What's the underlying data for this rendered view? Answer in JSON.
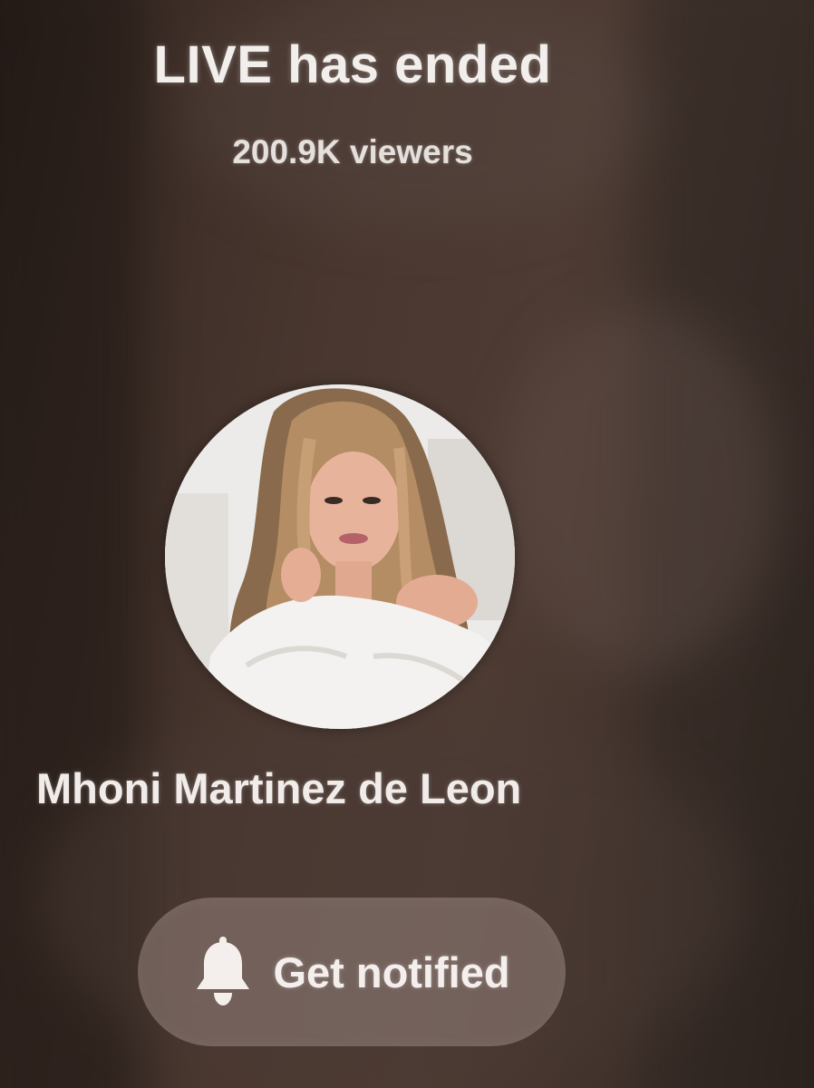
{
  "live_ended": {
    "title": "LIVE has ended",
    "viewers": "200.9K viewers"
  },
  "host": {
    "name": "Mhoni Martinez de Leon",
    "avatar": "profile-photo"
  },
  "actions": {
    "notify_label": "Get notified",
    "notify_icon": "bell-icon"
  },
  "colors": {
    "background": "#3a2c26",
    "text": "#f2eeec",
    "button_bg": "#96827c"
  }
}
